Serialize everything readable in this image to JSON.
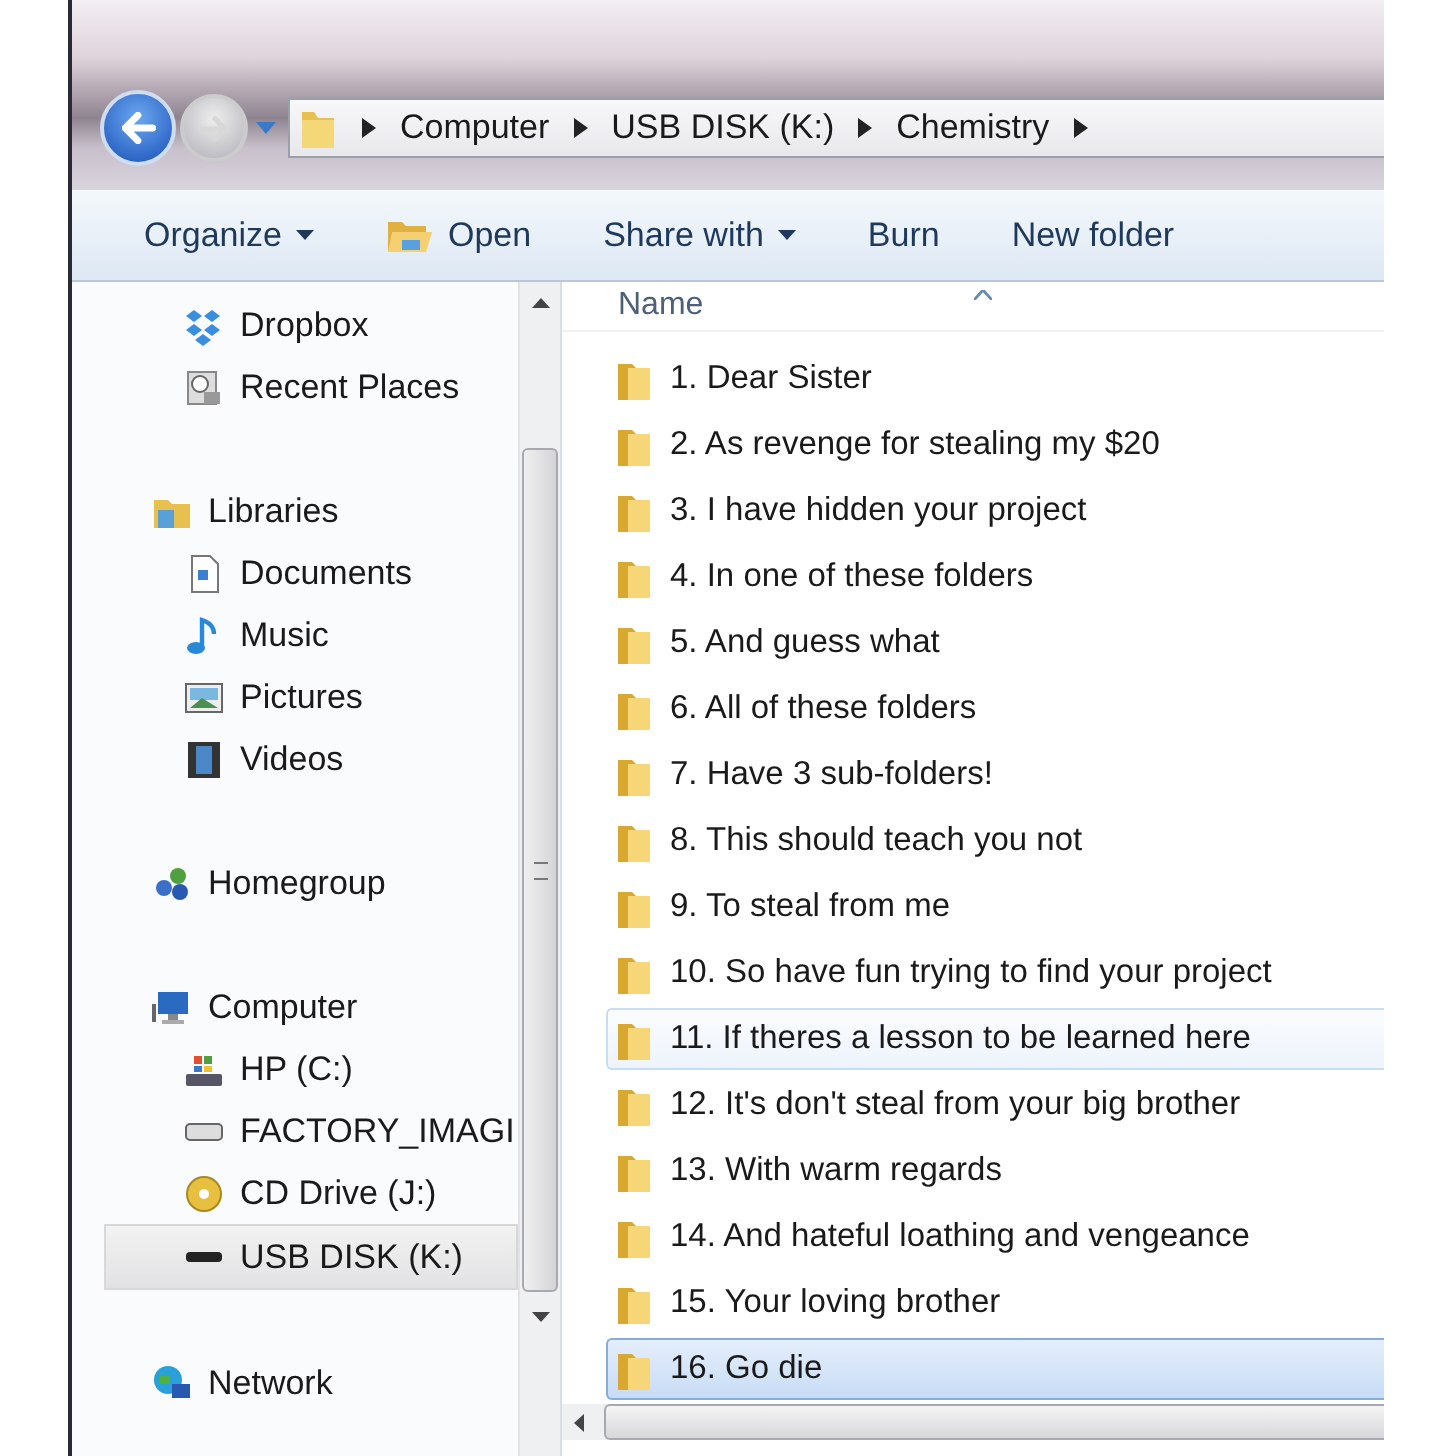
{
  "address_bar": {
    "segments": [
      "Computer",
      "USB DISK (K:)",
      "Chemistry"
    ]
  },
  "toolbar": [
    {
      "label": "Organize",
      "kind": "menu"
    },
    {
      "label": "Open",
      "kind": "icon"
    },
    {
      "label": "Share with",
      "kind": "menu"
    },
    {
      "label": "Burn",
      "kind": "plain"
    },
    {
      "label": "New folder",
      "kind": "plain"
    }
  ],
  "sidebar": {
    "sections": [
      {
        "items": [
          {
            "label": "Dropbox",
            "selected": false
          },
          {
            "label": "Recent Places",
            "selected": false
          }
        ]
      },
      {
        "header": "Libraries",
        "items": [
          {
            "label": "Documents",
            "selected": false
          },
          {
            "label": "Music",
            "selected": false
          },
          {
            "label": "Pictures",
            "selected": false
          },
          {
            "label": "Videos",
            "selected": false
          }
        ]
      },
      {
        "header": "Homegroup"
      },
      {
        "header": "Computer",
        "items": [
          {
            "label": "HP (C:)",
            "selected": false
          },
          {
            "label": "FACTORY_IMAGI",
            "selected": false
          },
          {
            "label": "CD Drive (J:)",
            "selected": false
          },
          {
            "label": "USB DISK (K:)",
            "selected": true
          }
        ]
      },
      {
        "header": "Network"
      }
    ]
  },
  "file_list": {
    "column": "Name",
    "rows": [
      {
        "name": "1. Dear Sister",
        "selected": false,
        "hovered": false
      },
      {
        "name": "2. As revenge for stealing my $20",
        "selected": false,
        "hovered": false
      },
      {
        "name": "3. I have hidden your project",
        "selected": false,
        "hovered": false
      },
      {
        "name": "4. In one of these folders",
        "selected": false,
        "hovered": false
      },
      {
        "name": "5. And guess what",
        "selected": false,
        "hovered": false
      },
      {
        "name": "6. All of these folders",
        "selected": false,
        "hovered": false
      },
      {
        "name": "7. Have 3 sub-folders!",
        "selected": false,
        "hovered": false
      },
      {
        "name": "8. This should teach you not",
        "selected": false,
        "hovered": false
      },
      {
        "name": "9. To steal from me",
        "selected": false,
        "hovered": false
      },
      {
        "name": "10. So have fun trying to find your project",
        "selected": false,
        "hovered": false
      },
      {
        "name": "11. If theres a lesson to be learned here",
        "selected": false,
        "hovered": true
      },
      {
        "name": "12. It's don't steal from your big brother",
        "selected": false,
        "hovered": false
      },
      {
        "name": "13. With warm regards",
        "selected": false,
        "hovered": false
      },
      {
        "name": "14. And hateful loathing and vengeance",
        "selected": false,
        "hovered": false
      },
      {
        "name": "15. Your loving brother",
        "selected": false,
        "hovered": false
      },
      {
        "name": "16. Go die",
        "selected": true,
        "hovered": false
      }
    ]
  }
}
